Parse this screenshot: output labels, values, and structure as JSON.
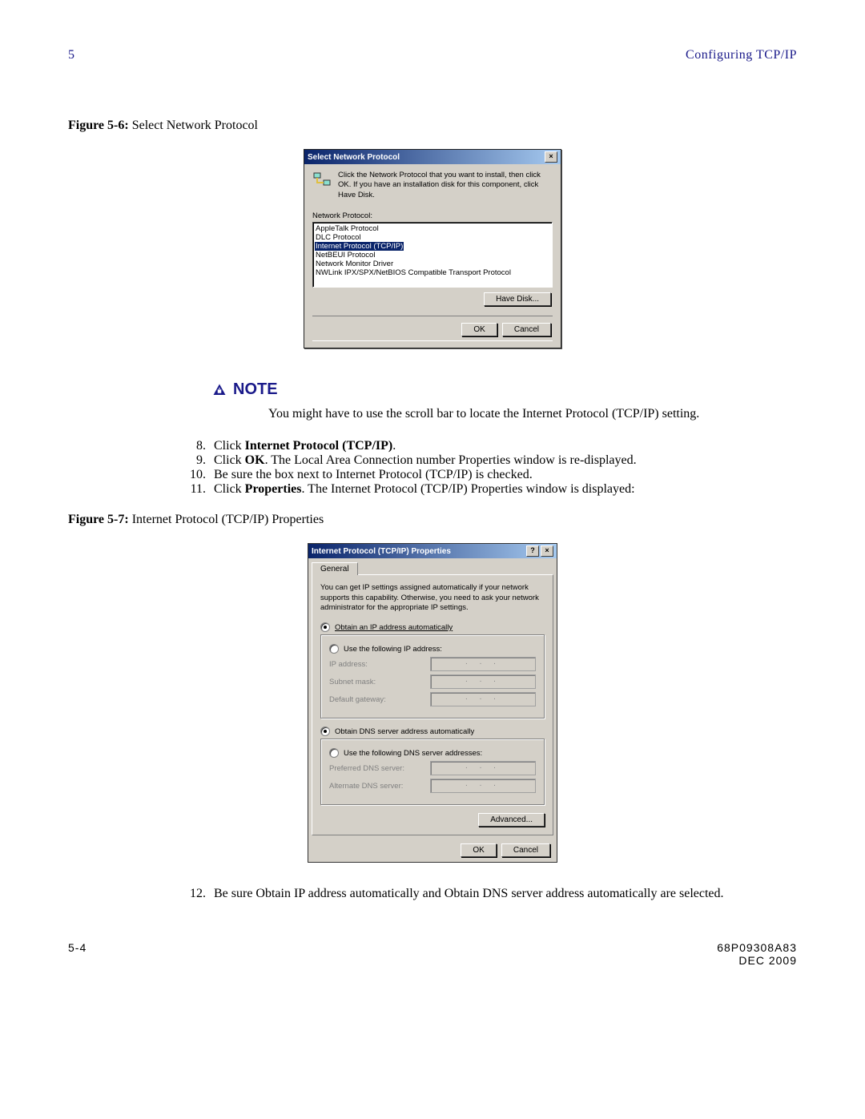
{
  "header": {
    "left": "5",
    "right": "Configuring TCP/IP"
  },
  "fig1": {
    "label": "Figure 5-6:",
    "title": " Select Network Protocol"
  },
  "dialog1": {
    "title": "Select Network Protocol",
    "close": "×",
    "info": "Click the Network Protocol that you want to install, then click OK. If you have an installation disk for this component, click Have Disk.",
    "listlabel": "Network Protocol:",
    "items": [
      "AppleTalk Protocol",
      "DLC Protocol",
      "Internet Protocol (TCP/IP)",
      "NetBEUI Protocol",
      "Network Monitor Driver",
      "NWLink IPX/SPX/NetBIOS Compatible Transport Protocol"
    ],
    "havedisk": "Have Disk...",
    "ok": "OK",
    "cancel": "Cancel"
  },
  "note": {
    "label": "NOTE",
    "text": "You might have to use the scroll bar to locate the Internet Protocol (TCP/IP) setting."
  },
  "steps": {
    "s8a": "Click ",
    "s8b": "Internet Protocol (TCP/IP)",
    "s8c": ".",
    "s9a": "Click ",
    "s9b": "OK",
    "s9c": ". The Local Area Connection number Properties window is re-displayed.",
    "s10": "Be sure the box next to Internet Protocol (TCP/IP) is checked.",
    "s11a": "Click ",
    "s11b": "Properties",
    "s11c": ". The Internet Protocol (TCP/IP) Properties window is displayed:"
  },
  "fig2": {
    "label": "Figure 5-7:",
    "title": " Internet Protocol (TCP/IP) Properties"
  },
  "dialog2": {
    "title": "Internet Protocol (TCP/IP) Properties",
    "help": "?",
    "close": "×",
    "tab": "General",
    "desc": "You can get IP settings assigned automatically if your network supports this capability. Otherwise, you need to ask your network administrator for the appropriate IP settings.",
    "r1": "Obtain an IP address automatically",
    "r2": "Use the following IP address:",
    "f1": "IP address:",
    "f2": "Subnet mask:",
    "f3": "Default gateway:",
    "r3": "Obtain DNS server address automatically",
    "r4": "Use the following DNS server addresses:",
    "f4": "Preferred DNS server:",
    "f5": "Alternate DNS server:",
    "advanced": "Advanced...",
    "ok": "OK",
    "cancel": "Cancel",
    "dots": ".   .   ."
  },
  "step12": {
    "num": "12.",
    "text": "Be sure Obtain IP address automatically and Obtain DNS server address automatically are selected."
  },
  "footer": {
    "left": "5-4",
    "r1": "68P09308A83",
    "r2": "DEC 2009"
  }
}
